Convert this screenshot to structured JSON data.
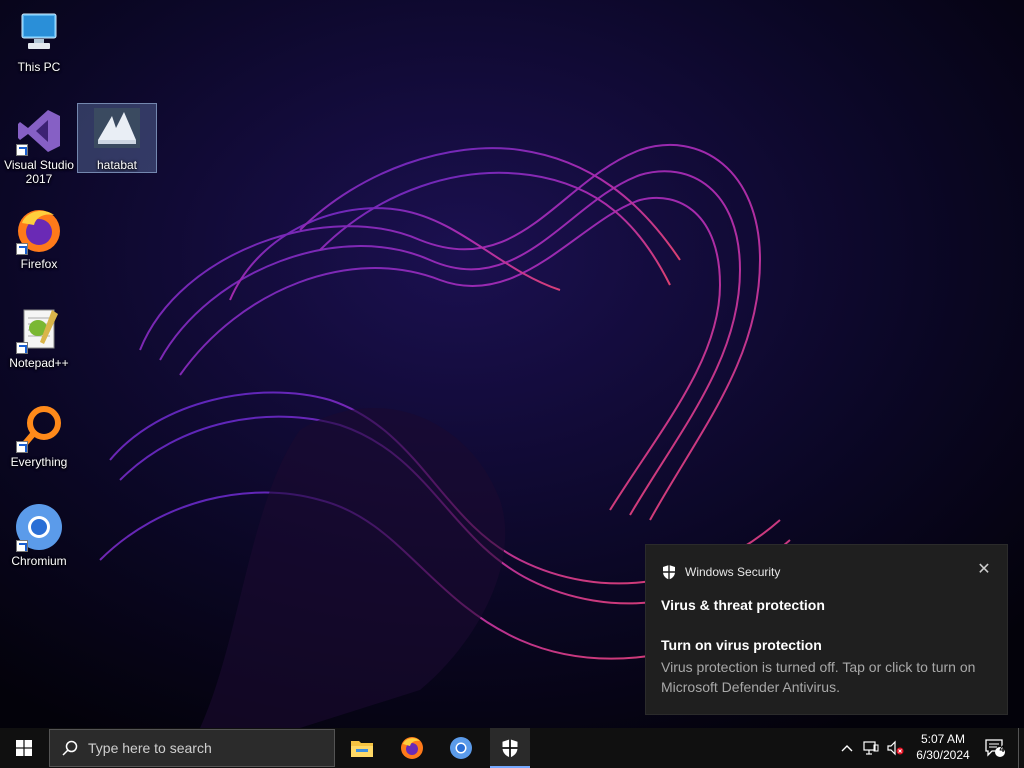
{
  "desktop": {
    "icons": [
      {
        "label": "This PC",
        "icon": "this-pc-icon"
      },
      {
        "label": "Visual Studio 2017",
        "icon": "visual-studio-icon"
      },
      {
        "label": "hatabat",
        "icon": "hatabat-icon"
      },
      {
        "label": "Firefox",
        "icon": "firefox-icon"
      },
      {
        "label": "Notepad++",
        "icon": "notepadpp-icon"
      },
      {
        "label": "Everything",
        "icon": "everything-icon"
      },
      {
        "label": "Chromium",
        "icon": "chromium-icon"
      }
    ]
  },
  "notification": {
    "app_name": "Windows Security",
    "title": "Virus & threat protection",
    "subtitle": "Turn on virus protection",
    "body": "Virus protection is turned off. Tap or click to turn on Microsoft Defender Antivirus.",
    "close_glyph": "✕"
  },
  "taskbar": {
    "search_placeholder": "Type here to search",
    "pinned": [
      "file-explorer-icon",
      "firefox-icon",
      "chromium-icon",
      "windows-security-icon"
    ],
    "clock": {
      "time": "5:07 AM",
      "date": "6/30/2024"
    },
    "notification_count": "4"
  },
  "colors": {
    "accent": "#76a9ff",
    "toast_bg": "#1f1f1f",
    "taskbar_bg": "#101010"
  }
}
